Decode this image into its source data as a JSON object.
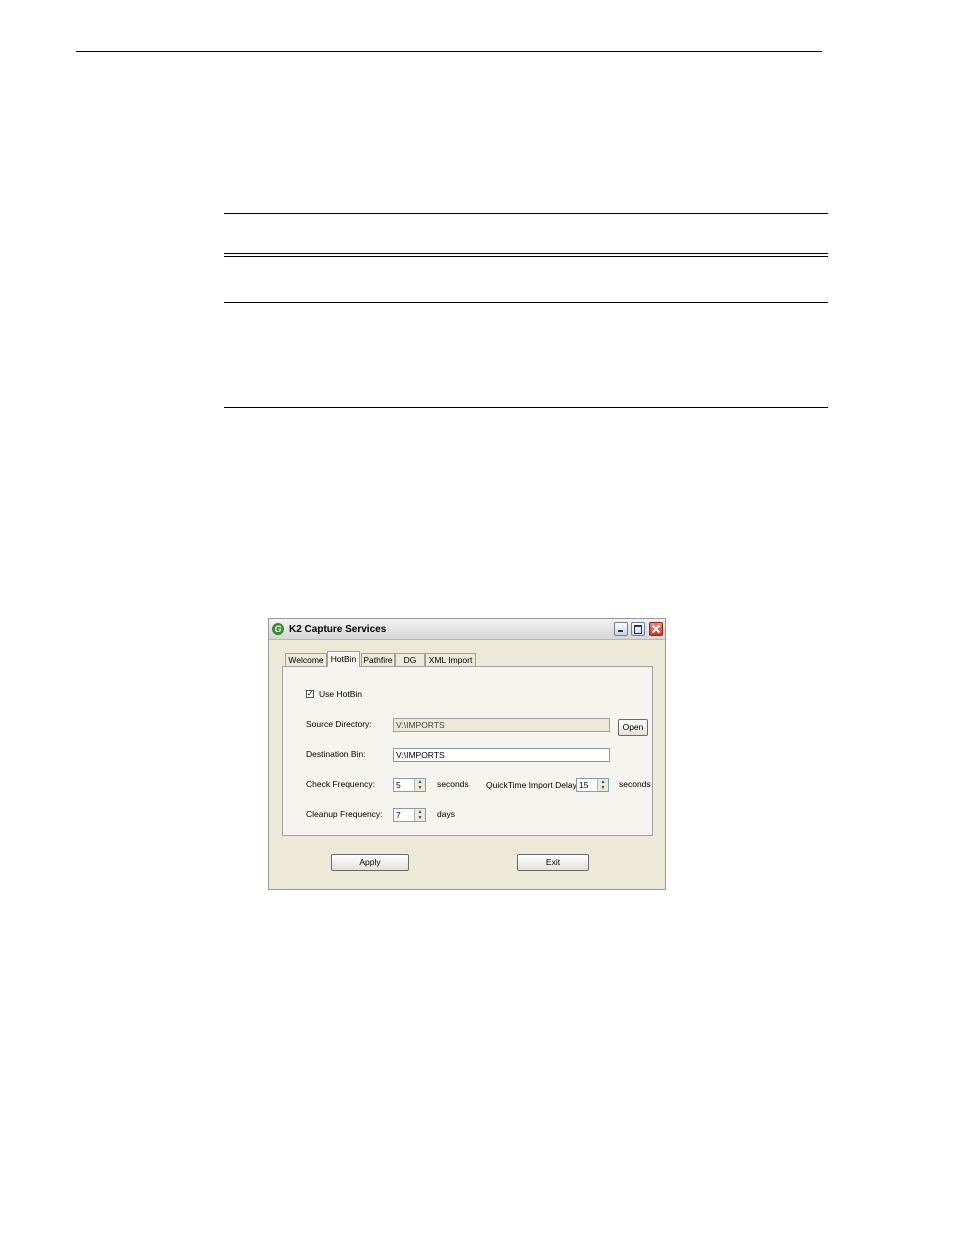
{
  "window": {
    "title": "K2 Capture Services",
    "app_icon_glyph": "G",
    "tabs": [
      "Welcome",
      "HotBin",
      "Pathfire",
      "DG",
      "XML Import"
    ],
    "active_tab": "HotBin"
  },
  "hotbin": {
    "use_hotbin_label": "Use HotBin",
    "use_hotbin_checked": true,
    "source_directory_label": "Source Directory:",
    "source_directory_value": "V:\\IMPORTS",
    "open_button": "Open",
    "destination_bin_label": "Destination Bin:",
    "destination_bin_value": "V:\\IMPORTS",
    "check_frequency_label": "Check Frequency:",
    "check_frequency_value": "5",
    "check_frequency_unit": "seconds",
    "qt_delay_label": "QuickTime Import Delay",
    "qt_delay_value": "15",
    "qt_delay_unit": "seconds",
    "cleanup_frequency_label": "Cleanup Frequency:",
    "cleanup_frequency_value": "7",
    "cleanup_frequency_unit": "days"
  },
  "footer": {
    "apply_button": "Apply",
    "exit_button": "Exit"
  }
}
